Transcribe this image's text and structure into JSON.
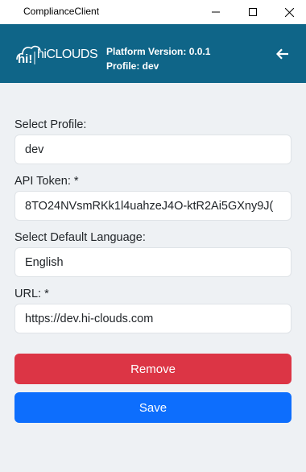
{
  "window": {
    "title": "ComplianceClient"
  },
  "header": {
    "logo_text": "hiCLOUDS",
    "platform_version": "Platform Version: 0.0.1",
    "profile": "Profile: dev"
  },
  "form": {
    "profile_label": "Select Profile:",
    "profile_value": "dev",
    "token_label": "API Token: *",
    "token_value": "8TO24NVsmRKk1l4uahzeJ4O-ktR2Ai5GXny9J(",
    "language_label": "Select Default Language:",
    "language_value": "English",
    "url_label": "URL: *",
    "url_value": "https://dev.hi-clouds.com"
  },
  "actions": {
    "remove_label": "Remove",
    "save_label": "Save"
  },
  "colors": {
    "header_bg": "#0f6588",
    "content_bg": "#eef1f4",
    "remove": "#dc3545",
    "save": "#0d6efd"
  }
}
